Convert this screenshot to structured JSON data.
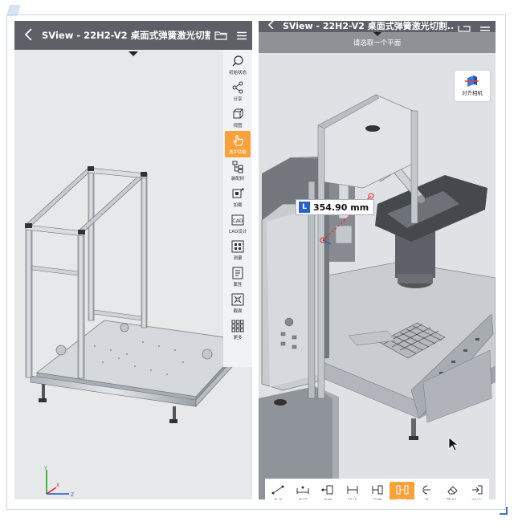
{
  "left": {
    "title": "SView - 22H2-V2 桌面式弹簧激光切割..",
    "tools": [
      {
        "label": "初始状态",
        "icon": "reset-view-icon"
      },
      {
        "label": "分享",
        "icon": "share-icon"
      },
      {
        "label": "视图",
        "icon": "view-cube-icon"
      },
      {
        "label": "选中功能",
        "icon": "hand-select-icon",
        "active": true
      },
      {
        "label": "装配树",
        "icon": "assembly-tree-icon"
      },
      {
        "label": "加载",
        "icon": "load-icon"
      },
      {
        "label": "CAD设计",
        "icon": "cad-design-icon"
      },
      {
        "label": "测量",
        "icon": "measure-icon"
      },
      {
        "label": "属性",
        "icon": "properties-icon"
      },
      {
        "label": "截面",
        "icon": "section-icon"
      },
      {
        "label": "更多",
        "icon": "more-grid-icon"
      }
    ],
    "axis": {
      "y": "Y",
      "x": "X",
      "z": "Z"
    }
  },
  "right": {
    "title": "SView - 22H2-V2 桌面式弹簧激光切割..",
    "hint": "请选取一个平面",
    "align_camera": "对齐相机",
    "measure_tag": "L",
    "measure_value": "354.90 mm",
    "bottom_tools": [
      {
        "label": "点点",
        "icon": "point-point-icon"
      },
      {
        "label": "点线",
        "icon": "point-line-icon"
      },
      {
        "label": "点面",
        "icon": "point-face-icon"
      },
      {
        "label": "线线",
        "icon": "line-line-icon"
      },
      {
        "label": "线面",
        "icon": "line-face-icon"
      },
      {
        "label": "面面",
        "icon": "face-face-icon",
        "active": true
      },
      {
        "label": "角",
        "icon": "angle-icon"
      },
      {
        "label": "删除",
        "icon": "eraser-icon"
      },
      {
        "label": "退出",
        "icon": "exit-icon"
      }
    ]
  },
  "colors": {
    "toolbar": "#5d6066",
    "accent": "#f7a23b",
    "measure_tag": "#2a62c4"
  }
}
